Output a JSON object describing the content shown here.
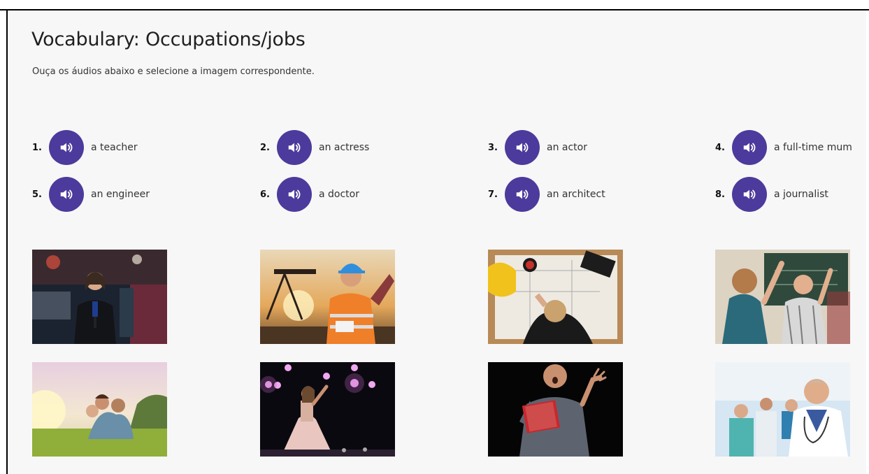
{
  "header": {
    "title": "Vocabulary: Occupations/jobs",
    "instruction": "Ouça os áudios abaixo e selecione a imagem correspondente."
  },
  "audio_items": [
    {
      "number": "1.",
      "label": "a teacher",
      "icon": "speaker-icon"
    },
    {
      "number": "2.",
      "label": "an actress",
      "icon": "speaker-icon"
    },
    {
      "number": "3.",
      "label": "an actor",
      "icon": "speaker-icon"
    },
    {
      "number": "4.",
      "label": "a full-time mum",
      "icon": "speaker-icon"
    },
    {
      "number": "5.",
      "label": "an engineer",
      "icon": "speaker-icon"
    },
    {
      "number": "6.",
      "label": "a doctor",
      "icon": "speaker-icon"
    },
    {
      "number": "7.",
      "label": "an architect",
      "icon": "speaker-icon"
    },
    {
      "number": "8.",
      "label": "a journalist",
      "icon": "speaker-icon"
    }
  ],
  "image_options": [
    {
      "depicts": "journalist reporting at night scene"
    },
    {
      "depicts": "engineer in hard hat at oil field"
    },
    {
      "depicts": "architect drawing plans at desk"
    },
    {
      "depicts": "teacher with student raising hand"
    },
    {
      "depicts": "mother with children on grass"
    },
    {
      "depicts": "actress on stage under lights"
    },
    {
      "depicts": "actor reading from red book"
    },
    {
      "depicts": "doctor with stethoscope in clinic"
    }
  ],
  "colors": {
    "accent": "#4c3a9c",
    "page_background": "#f7f7f7",
    "frame": "#000000"
  }
}
